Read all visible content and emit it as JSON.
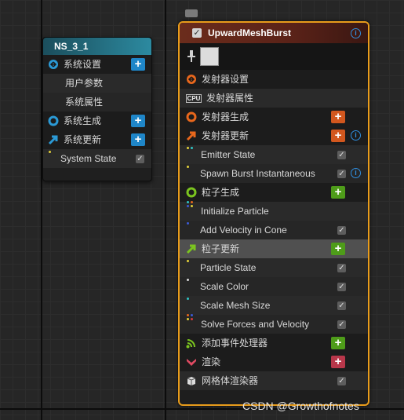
{
  "system_node": {
    "title": "NS_3_1",
    "rows": [
      {
        "label": "系统设置",
        "icon": "system-settings-icon",
        "has_plus": true
      },
      {
        "label": "用户参数"
      },
      {
        "label": "系统属性"
      },
      {
        "label": "系统生成",
        "icon": "spawn-ring-icon",
        "has_plus": true
      },
      {
        "label": "系统更新",
        "icon": "update-arrow-icon",
        "has_plus": true
      },
      {
        "label": "System State",
        "checked": true
      }
    ]
  },
  "emitter_node": {
    "title": "UpwardMeshBurst",
    "rows": [
      {
        "label": "发射器设置"
      },
      {
        "label": "发射器属性"
      },
      {
        "label": "发射器生成"
      },
      {
        "label": "发射器更新"
      },
      {
        "label": "Emitter State"
      },
      {
        "label": "Spawn Burst Instantaneous"
      },
      {
        "label": "粒子生成"
      },
      {
        "label": "Initialize Particle"
      },
      {
        "label": "Add Velocity in Cone"
      },
      {
        "label": "粒子更新"
      },
      {
        "label": "Particle State"
      },
      {
        "label": "Scale Color"
      },
      {
        "label": "Scale Mesh Size"
      },
      {
        "label": "Solve Forces and Velocity"
      },
      {
        "label": "添加事件处理器"
      },
      {
        "label": "渲染"
      },
      {
        "label": "网格体渲染器"
      }
    ]
  },
  "watermark": "CSDN @Growthofnotes",
  "colors": {
    "accent": "#e89c1b",
    "system_header": "#2c8aa0",
    "plus_blue": "#1f86c8",
    "plus_orange": "#d2571e",
    "plus_green": "#4e9c19",
    "plus_red": "#b8374a"
  }
}
